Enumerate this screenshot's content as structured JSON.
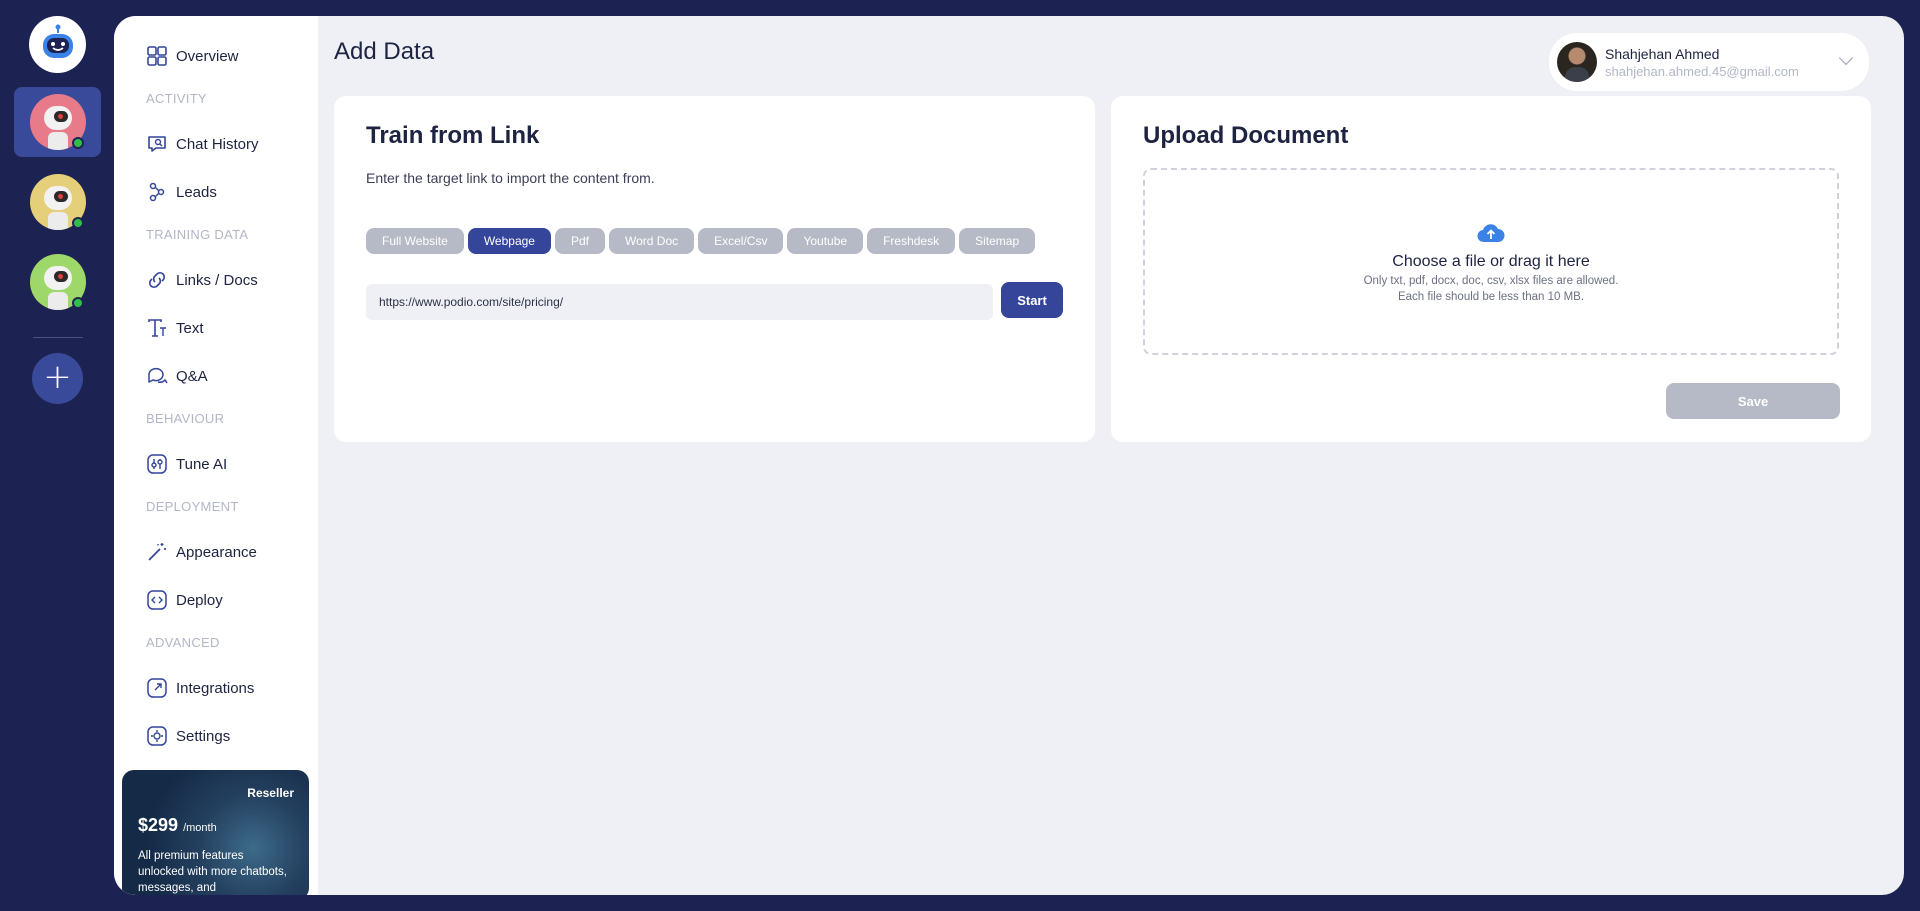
{
  "header": {
    "title": "Add Data"
  },
  "user": {
    "name": "Shahjehan Ahmed",
    "email": "shahjehan.ahmed.45@gmail.com"
  },
  "rail": {
    "add_label": "+"
  },
  "sidebar": {
    "overview": "Overview",
    "sections": {
      "activity": "ACTIVITY",
      "training": "TRAINING DATA",
      "behaviour": "BEHAVIOUR",
      "deployment": "DEPLOYMENT",
      "advanced": "ADVANCED"
    },
    "items": {
      "chat_history": "Chat History",
      "leads": "Leads",
      "links_docs": "Links / Docs",
      "text": "Text",
      "qa": "Q&A",
      "tune_ai": "Tune AI",
      "appearance": "Appearance",
      "deploy": "Deploy",
      "integrations": "Integrations",
      "settings": "Settings"
    },
    "promo": {
      "badge": "Reseller",
      "price": "$299",
      "period": "/month",
      "text": "All premium features unlocked with more chatbots, messages, and"
    }
  },
  "train_link": {
    "title": "Train from Link",
    "subtitle": "Enter the target link to import the content from.",
    "tabs": [
      "Full Website",
      "Webpage",
      "Pdf",
      "Word Doc",
      "Excel/Csv",
      "Youtube",
      "Freshdesk",
      "Sitemap"
    ],
    "active_tab": "Webpage",
    "url_value": "https://www.podio.com/site/pricing/",
    "start_label": "Start"
  },
  "upload": {
    "title": "Upload Document",
    "drop_title": "Choose a file or drag it here",
    "hint1": "Only txt, pdf, docx, doc, csv, xlsx files are allowed.",
    "hint2": "Each file should be less than 10 MB.",
    "save_label": "Save"
  },
  "colors": {
    "rail_bg": "#1c2352",
    "accent": "#34459a",
    "muted_button": "#b6bac6",
    "upload_icon": "#3b82e6",
    "online": "#2fbf4a"
  },
  "icons": {
    "overview": "grid-icon",
    "chat_history": "chat-search-icon",
    "leads": "people-network-icon",
    "links_docs": "link-icon",
    "text": "text-type-icon",
    "qa": "qa-bubbles-icon",
    "tune_ai": "sliders-icon",
    "appearance": "magic-wand-icon",
    "deploy": "code-icon",
    "integrations": "external-link-icon",
    "settings": "settings-icon",
    "upload": "cloud-upload-icon"
  }
}
